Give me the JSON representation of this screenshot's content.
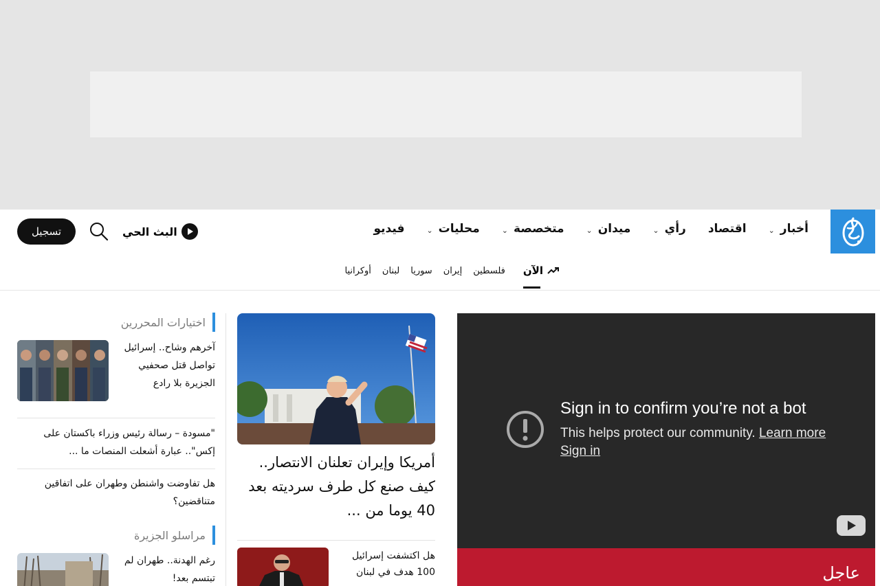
{
  "nav": {
    "items": [
      {
        "label": "أخبار",
        "has_dropdown": true
      },
      {
        "label": "اقتصاد",
        "has_dropdown": false
      },
      {
        "label": "رأي",
        "has_dropdown": true
      },
      {
        "label": "ميدان",
        "has_dropdown": true
      },
      {
        "label": "متخصصة",
        "has_dropdown": true
      },
      {
        "label": "محليات",
        "has_dropdown": true
      },
      {
        "label": "فيديو",
        "has_dropdown": false
      }
    ],
    "live_label": "البث الحي",
    "register_label": "تسجيل",
    "search_icon": "search-icon"
  },
  "subnav": {
    "trending_label": "الآن",
    "links": [
      "فلسطين",
      "إيران",
      "سوريا",
      "لبنان",
      "أوكرانيا"
    ]
  },
  "video": {
    "title": "Sign in to confirm you’re not a bot",
    "subtitle": "This helps protect our community.",
    "learn_more": "Learn more",
    "sign_in": "Sign in"
  },
  "breaking": {
    "label": "عاجل"
  },
  "featured": {
    "title": "أمريكا وإيران تعلنان الانتصار.. كيف صنع كل طرف سرديته بعد 40 يوما من ...",
    "secondary_title": "هل اكتشفت إسرائيل 100 هدف في لبنان"
  },
  "sidebar": {
    "editors_heading": "اختيارات المحررين",
    "editors_lead": "آخرهم وشاح.. إسرائيل تواصل قتل صحفيي الجزيرة بلا رادع",
    "items": [
      "\"مسودة – رسالة رئيس وزراء باكستان على إكس\".. عبارة أشعلت المنصات ما ...",
      "هل تفاوضت واشنطن وطهران على اتفاقين متناقضين؟"
    ],
    "correspondents_heading": "مراسلو الجزيرة",
    "correspondents_lead": "رغم الهدنة.. طهران لم تبتسم بعد!"
  },
  "colors": {
    "accent": "#2c8fde",
    "breaking": "#bd1a2f",
    "video_bg": "#282828",
    "ad_bg": "#e5e5e5"
  }
}
